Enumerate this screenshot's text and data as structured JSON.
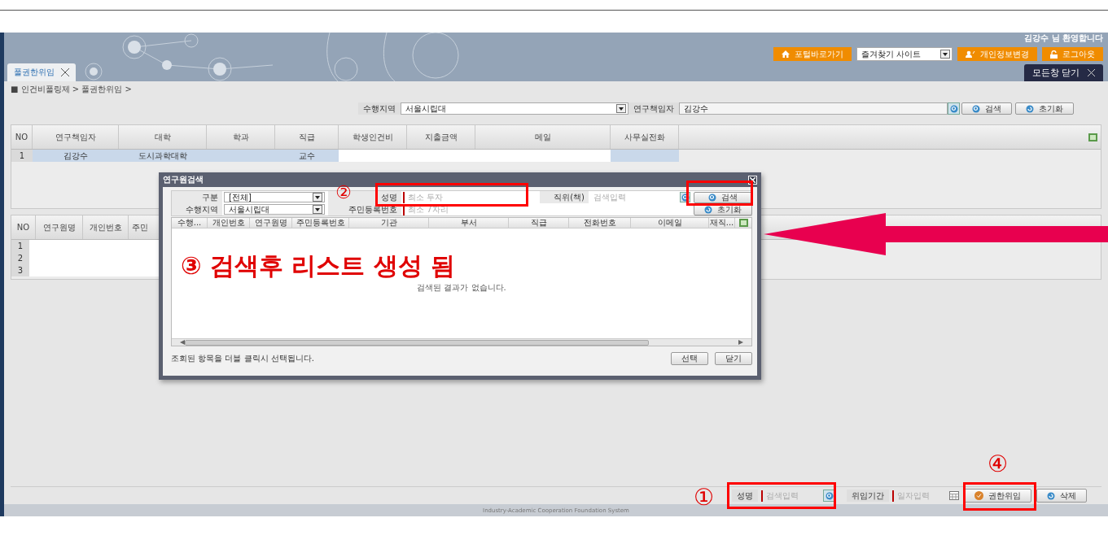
{
  "header": {
    "welcome": "김강수 님 환영합니다",
    "portal_button": "포털바로가기",
    "favorites_select": "즐겨찾기 사이트",
    "profile_button": "개인정보변경",
    "logout_button": "로그아웃",
    "close_all_button": "모든창 닫기"
  },
  "tabs": [
    {
      "label": "풀권한위임",
      "selected": true
    }
  ],
  "breadcrumb": "■ 인건비풀링제 > 풀권한위임 >",
  "search_bar": {
    "region_label": "수행지역",
    "region_value": "서울시립대",
    "leader_label": "연구책임자",
    "leader_value": "김강수",
    "search_button": "검색",
    "reset_button": "초기화"
  },
  "leader_grid": {
    "columns": [
      "NO",
      "연구책임자",
      "대학",
      "학과",
      "직급",
      "학생인건비",
      "지출금액",
      "메일",
      "사무실전화"
    ],
    "rows": [
      {
        "selected": true,
        "cells": [
          "1",
          "김강수",
          "도시과학대학",
          null,
          "교수",
          null,
          null,
          null,
          null
        ]
      }
    ]
  },
  "researcher_grid": {
    "columns": [
      "NO",
      "연구원명",
      "개인번호",
      "주민"
    ],
    "rows": [
      {
        "no": "1"
      },
      {
        "no": "2"
      },
      {
        "no": "3"
      }
    ]
  },
  "dialog": {
    "title": "연구원검색",
    "type_label": "구분",
    "type_value": "[전체]",
    "region_label": "수행지역",
    "region_value": "서울시립대",
    "name_label": "성명",
    "name_placeholder": "최소 두자",
    "rrn_label": "주민등록번호",
    "rrn_placeholder": "최소 7자리",
    "position_label": "직위(책)",
    "position_placeholder": "검색입력",
    "search_button": "검색",
    "reset_button": "초기화",
    "columns": [
      "수행...",
      "개인번호",
      "연구원명",
      "주민등록번호",
      "기관",
      "부서",
      "직급",
      "전화번호",
      "이메일",
      "재직..."
    ],
    "empty_message": "검색된 결과가 없습니다.",
    "hint": "조회된 항목을 더블 클릭시 선택됩니다.",
    "select_button": "선택",
    "close_button": "닫기"
  },
  "bottom_bar": {
    "name_label": "성명",
    "name_placeholder": "검색입력",
    "period_label": "위임기간",
    "period_placeholder": "일자입력",
    "delegate_button": "권한위임",
    "delete_button": "삭제"
  },
  "footer": "Industry-Academic Cooperation Foundation System",
  "annotations": [
    {
      "kind": "marker",
      "text": "①"
    },
    {
      "kind": "marker",
      "text": "②"
    },
    {
      "kind": "note",
      "text": "③ 검색후 리스트 생성 됨"
    },
    {
      "kind": "marker",
      "text": "④"
    }
  ]
}
